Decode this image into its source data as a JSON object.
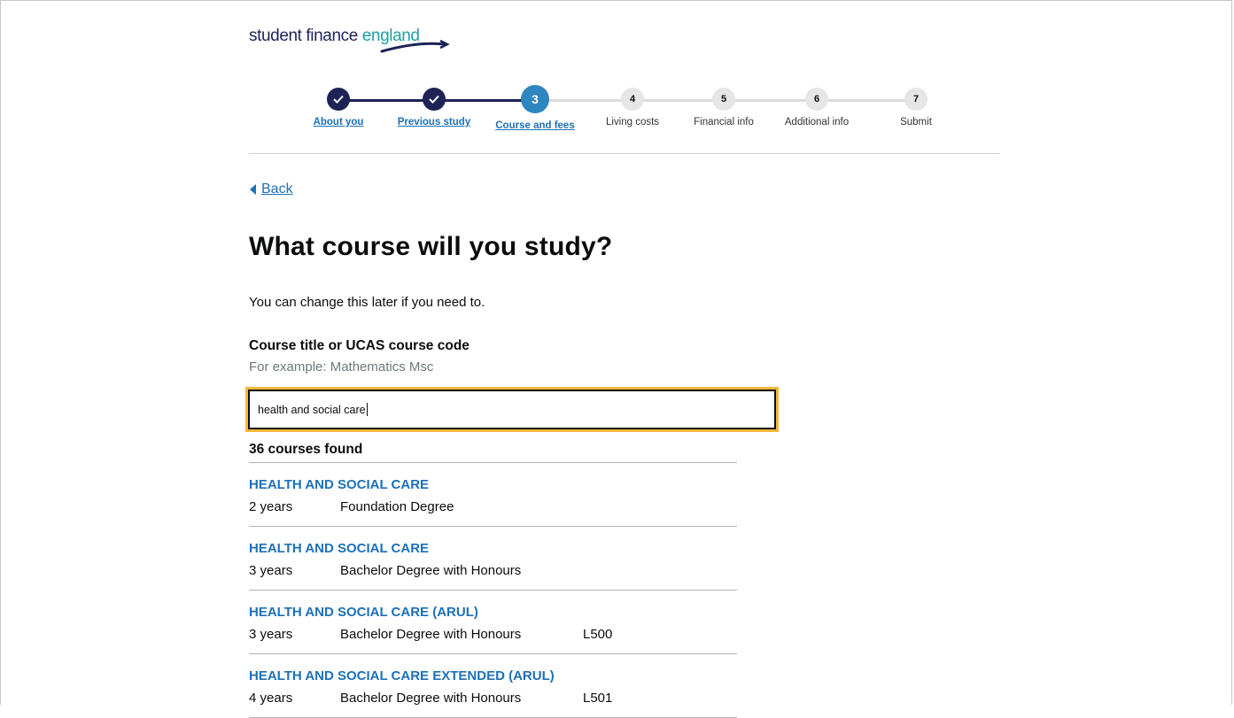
{
  "brand": {
    "word1": "student finance ",
    "word2": "england"
  },
  "progress": {
    "steps": [
      {
        "number": "1",
        "label": "About you",
        "state": "done"
      },
      {
        "number": "2",
        "label": "Previous study",
        "state": "done"
      },
      {
        "number": "3",
        "label": "Course and fees",
        "state": "current"
      },
      {
        "number": "4",
        "label": "Living costs",
        "state": "todo"
      },
      {
        "number": "5",
        "label": "Financial info",
        "state": "todo"
      },
      {
        "number": "6",
        "label": "Additional info",
        "state": "todo"
      },
      {
        "number": "7",
        "label": "Submit",
        "state": "todo"
      }
    ]
  },
  "nav": {
    "back_label": "Back"
  },
  "page": {
    "title": "What course will you study?",
    "intro": "You can change this later if you need to."
  },
  "search": {
    "label": "Course title or UCAS course code",
    "hint": "For example: Mathematics Msc",
    "value": "health and social care"
  },
  "results": {
    "count_text": "36 courses found",
    "items": [
      {
        "title": "HEALTH AND SOCIAL CARE",
        "duration": "2 years",
        "type": "Foundation Degree",
        "code": ""
      },
      {
        "title": "HEALTH AND SOCIAL CARE",
        "duration": "3 years",
        "type": "Bachelor Degree with Honours",
        "code": ""
      },
      {
        "title": "HEALTH AND SOCIAL CARE (ARUL)",
        "duration": "3 years",
        "type": "Bachelor Degree with Honours",
        "code": "L500"
      },
      {
        "title": "HEALTH AND SOCIAL CARE EXTENDED (ARUL)",
        "duration": "4 years",
        "type": "Bachelor Degree with Honours",
        "code": "L501"
      }
    ]
  },
  "colors": {
    "brand_navy": "#1d2355",
    "brand_teal": "#1aa3a3",
    "current_step": "#2e86c1",
    "link": "#1d70b8",
    "focus": "#f3b53a"
  },
  "icons": {
    "done_step": "check-icon",
    "back": "triangle-left-icon"
  }
}
